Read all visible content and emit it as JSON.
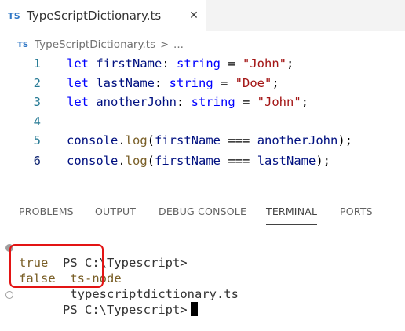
{
  "tab": {
    "icon_text": "TS",
    "title": "TypeScriptDictionary.ts",
    "close": "✕"
  },
  "breadcrumb": {
    "icon_text": "TS",
    "file": "TypeScriptDictionary.ts",
    "separator": ">",
    "more": "..."
  },
  "editor": {
    "lines": [
      {
        "num": "1",
        "tokens": [
          [
            "kw",
            "let"
          ],
          [
            "plain",
            " "
          ],
          [
            "var",
            "firstName"
          ],
          [
            "plain",
            ": "
          ],
          [
            "type",
            "string"
          ],
          [
            "plain",
            " = "
          ],
          [
            "str",
            "\"John\""
          ],
          [
            "plain",
            ";"
          ]
        ]
      },
      {
        "num": "2",
        "tokens": [
          [
            "kw",
            "let"
          ],
          [
            "plain",
            " "
          ],
          [
            "var",
            "lastName"
          ],
          [
            "plain",
            ": "
          ],
          [
            "type",
            "string"
          ],
          [
            "plain",
            " = "
          ],
          [
            "str",
            "\"Doe\""
          ],
          [
            "plain",
            ";"
          ]
        ]
      },
      {
        "num": "3",
        "tokens": [
          [
            "kw",
            "let"
          ],
          [
            "plain",
            " "
          ],
          [
            "var",
            "anotherJohn"
          ],
          [
            "plain",
            ": "
          ],
          [
            "type",
            "string"
          ],
          [
            "plain",
            " = "
          ],
          [
            "str",
            "\"John\""
          ],
          [
            "plain",
            ";"
          ]
        ]
      },
      {
        "num": "4",
        "tokens": []
      },
      {
        "num": "5",
        "tokens": [
          [
            "var",
            "console"
          ],
          [
            "plain",
            "."
          ],
          [
            "fn",
            "log"
          ],
          [
            "plain",
            "("
          ],
          [
            "var",
            "firstName"
          ],
          [
            "plain",
            " === "
          ],
          [
            "var",
            "anotherJohn"
          ],
          [
            "plain",
            ");"
          ]
        ]
      },
      {
        "num": "6",
        "tokens": [
          [
            "var",
            "console"
          ],
          [
            "plain",
            "."
          ],
          [
            "fn",
            "log"
          ],
          [
            "plain",
            "("
          ],
          [
            "var",
            "firstName"
          ],
          [
            "plain",
            " === "
          ],
          [
            "var",
            "lastName"
          ],
          [
            "plain",
            ");"
          ]
        ]
      }
    ],
    "current_line": "6"
  },
  "panel": {
    "tabs": [
      "PROBLEMS",
      "OUTPUT",
      "DEBUG CONSOLE",
      "TERMINAL",
      "PORTS"
    ],
    "active_tab": "TERMINAL"
  },
  "terminal": {
    "prompt": "PS C:\\Typescript>",
    "command": "ts-node",
    "argument": "typescriptdictionary.ts",
    "output": [
      "true",
      "false"
    ],
    "prompt2": "PS C:\\Typescript>"
  },
  "colors": {
    "highlight_box": "#e31414",
    "ts_icon": "#3178c6"
  }
}
